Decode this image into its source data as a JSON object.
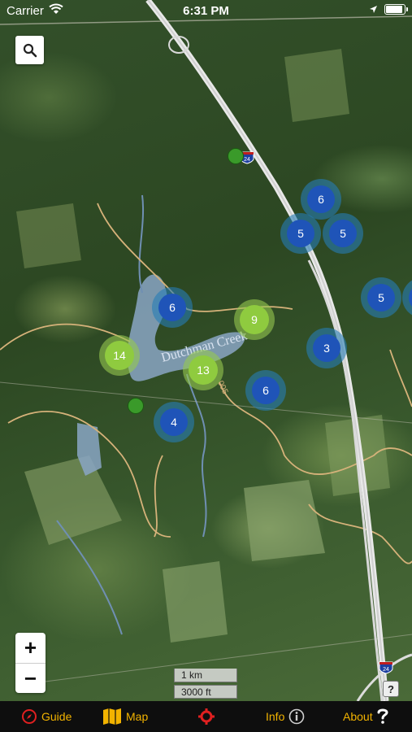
{
  "status_bar": {
    "carrier": "Carrier",
    "time": "6:31 PM"
  },
  "map": {
    "lake_label": "Dutchman Creek",
    "road_label": "005",
    "clusters": [
      {
        "count": "6",
        "kind": "blue"
      },
      {
        "count": "5",
        "kind": "blue"
      },
      {
        "count": "5",
        "kind": "blue"
      },
      {
        "count": "5",
        "kind": "blue"
      },
      {
        "count": "6",
        "kind": "blue"
      },
      {
        "count": "9",
        "kind": "green"
      },
      {
        "count": "14",
        "kind": "green"
      },
      {
        "count": "13",
        "kind": "green"
      },
      {
        "count": "3",
        "kind": "blue"
      },
      {
        "count": "6",
        "kind": "blue"
      },
      {
        "count": "4",
        "kind": "blue"
      }
    ],
    "highway_shield": "24",
    "scale": {
      "metric": "1 km",
      "imperial": "3000 ft"
    },
    "help": "?",
    "colors": {
      "cluster_blue": "#1f54b8",
      "cluster_green": "#8fcb3f",
      "tab_accent": "#f2b300",
      "target_red": "#e02020"
    }
  },
  "controls": {
    "zoom_in": "+",
    "zoom_out": "−"
  },
  "tabs": [
    {
      "label": "Guide",
      "icon": "compass-icon"
    },
    {
      "label": "Map",
      "icon": "map-icon"
    },
    {
      "label": "",
      "icon": "target-icon"
    },
    {
      "label": "Info",
      "icon": "info-icon"
    },
    {
      "label": "About",
      "icon": "question-icon"
    }
  ]
}
